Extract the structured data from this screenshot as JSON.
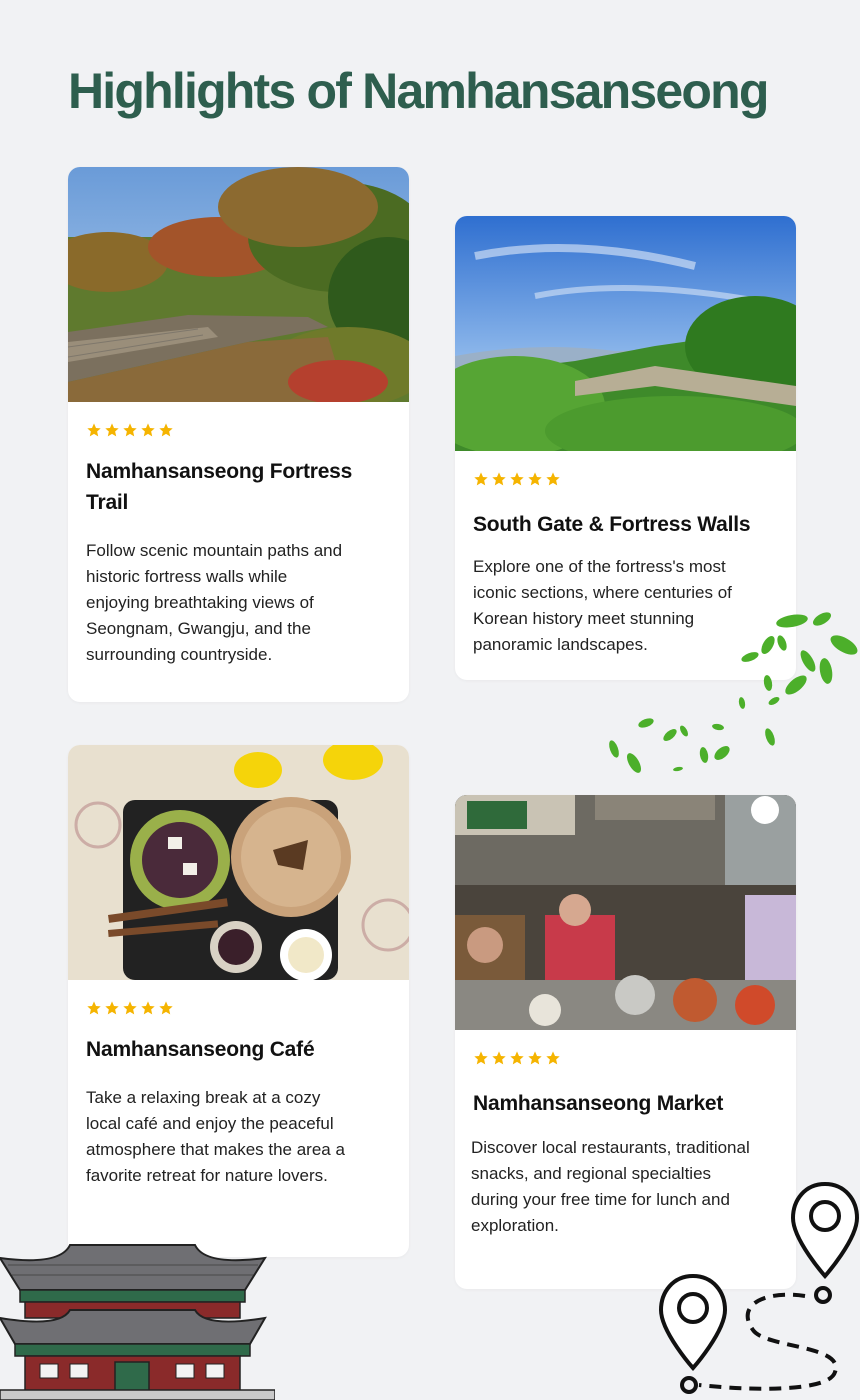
{
  "page": {
    "title": "Highlights of Namhansanseong"
  },
  "colors": {
    "title": "#2e5e4e",
    "star": "#f5b400",
    "background": "#f1f2f4",
    "card": "#ffffff",
    "leaf": "#4caf2a"
  },
  "cards": [
    {
      "title": "Namhansanseong Fortress Trail",
      "rating": 5,
      "description": "Follow scenic mountain paths and historic fortress walls while enjoying breathtaking views of Seongnam, Gwangju, and the surrounding countryside.",
      "image": "autumn-fortress-wall-photo"
    },
    {
      "title": "South Gate & Fortress Walls",
      "rating": 5,
      "description": "Explore one of the fortress's most iconic sections, where centuries of Korean history meet stunning panoramic landscapes.",
      "image": "summer-fortress-wall-photo"
    },
    {
      "title": "Namhansanseong Café",
      "rating": 5,
      "description": "Take a relaxing break at a cozy local café and enjoy the peaceful atmosphere that makes the area a favorite retreat for nature lovers.",
      "image": "cafe-bingsu-dessert-photo"
    },
    {
      "title": "Namhansanseong Market",
      "rating": 5,
      "description": "Discover local restaurants, traditional snacks, and regional specialties during your free time for lunch and exploration.",
      "image": "traditional-market-photo"
    }
  ],
  "decorations": {
    "icons": [
      "leaves-icon",
      "korean-gate-icon",
      "map-pin-route-icon"
    ]
  }
}
